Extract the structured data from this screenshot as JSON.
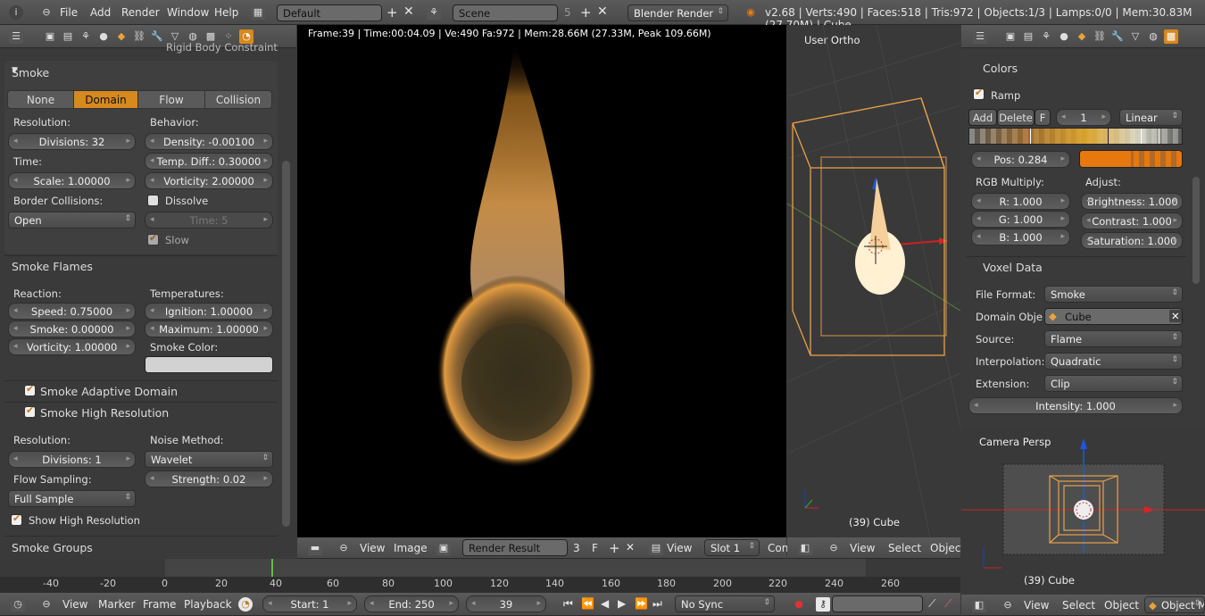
{
  "topbar": {
    "menus": [
      "File",
      "Add",
      "Render",
      "Window",
      "Help"
    ],
    "layout": "Default",
    "scene": "Scene",
    "scene_users": "5",
    "engine": "Blender Render",
    "stats": "v2.68 | Verts:490 | Faces:518 | Tris:972 | Objects:1/3 | Lamps:0/0 | Mem:30.83M (27.70M) | Cube"
  },
  "left": {
    "prev_panel": "Rigid Body Constraint",
    "smoke": {
      "title": "Smoke",
      "types": [
        "None",
        "Domain",
        "Flow",
        "Collision"
      ],
      "active": "Domain",
      "resolution_label": "Resolution:",
      "divisions": "Divisions: 32",
      "time_label": "Time:",
      "scale": "Scale: 1.00000",
      "border_label": "Border Collisions:",
      "border_value": "Open",
      "behavior_label": "Behavior:",
      "density": "Density: -0.00100",
      "temp_diff": "Temp. Diff.: 0.30000",
      "vorticity": "Vorticity: 2.00000",
      "dissolve": "Dissolve",
      "time": "Time: 5",
      "slow": "Slow"
    },
    "flames": {
      "title": "Smoke Flames",
      "reaction_label": "Reaction:",
      "speed": "Speed: 0.75000",
      "smoke": "Smoke: 0.00000",
      "vorticity": "Vorticity: 1.00000",
      "temps_label": "Temperatures:",
      "ignition": "Ignition: 1.00000",
      "maximum": "Maximum: 1.00000",
      "color_label": "Smoke Color:"
    },
    "adaptive": {
      "title": "Smoke Adaptive Domain"
    },
    "highres": {
      "title": "Smoke High Resolution",
      "resolution_label": "Resolution:",
      "divisions": "Divisions: 1",
      "noise_label": "Noise Method:",
      "noise_value": "Wavelet",
      "flow_label": "Flow Sampling:",
      "flow_value": "Full Sample",
      "strength": "Strength: 0.02",
      "show": "Show High Resolution"
    },
    "groups": {
      "title": "Smoke Groups"
    }
  },
  "render": {
    "overlay": "Frame:39 | Time:00:04.09 | Ve:490 Fa:972 | Mem:28.66M (27.33M, Peak 109.66M)",
    "footer": {
      "view": "View",
      "image": "Image",
      "result": "Render Result",
      "users": "3",
      "f": "F",
      "view2": "View",
      "slot": "Slot 1",
      "con": "Con"
    }
  },
  "viewport": {
    "label": "User Ortho",
    "object": "(39) Cube",
    "footer": [
      "View",
      "Select",
      "Object"
    ]
  },
  "right": {
    "colors": {
      "title": "Colors",
      "ramp": "Ramp",
      "add": "Add",
      "delete": "Delete",
      "f": "F",
      "index": "1",
      "interp": "Linear",
      "pos": "Pos: 0.284",
      "rgb_label": "RGB Multiply:",
      "r": "R: 1.000",
      "g": "G: 1.000",
      "b": "B: 1.000",
      "adjust_label": "Adjust:",
      "brightness": "Brightness: 1.000",
      "contrast": "Contrast: 1.000",
      "saturation": "Saturation: 1.000"
    },
    "voxel": {
      "title": "Voxel Data",
      "format_label": "File Format:",
      "format": "Smoke",
      "domain_label": "Domain Obje",
      "domain": "Cube",
      "source_label": "Source:",
      "source": "Flame",
      "interp_label": "Interpolation:",
      "interp": "Quadratic",
      "ext_label": "Extension:",
      "ext": "Clip",
      "intensity": "Intensity: 1.000"
    },
    "camera": {
      "label": "Camera Persp",
      "object": "(39) Cube"
    },
    "footer": [
      "View",
      "Select",
      "Object",
      "Object Mo"
    ]
  },
  "timeline": {
    "ticks": [
      "-40",
      "-20",
      "0",
      "20",
      "40",
      "60",
      "80",
      "100",
      "120",
      "140",
      "160",
      "180",
      "200",
      "220",
      "240",
      "260"
    ],
    "menus": [
      "View",
      "Marker",
      "Frame",
      "Playback"
    ],
    "start": "Start: 1",
    "end": "End: 250",
    "frame": "39",
    "sync": "No Sync",
    "current_frame": 39
  },
  "colors": {
    "accent": "#d6891f",
    "bg": "#3a3a3a",
    "panel": "#737373"
  }
}
